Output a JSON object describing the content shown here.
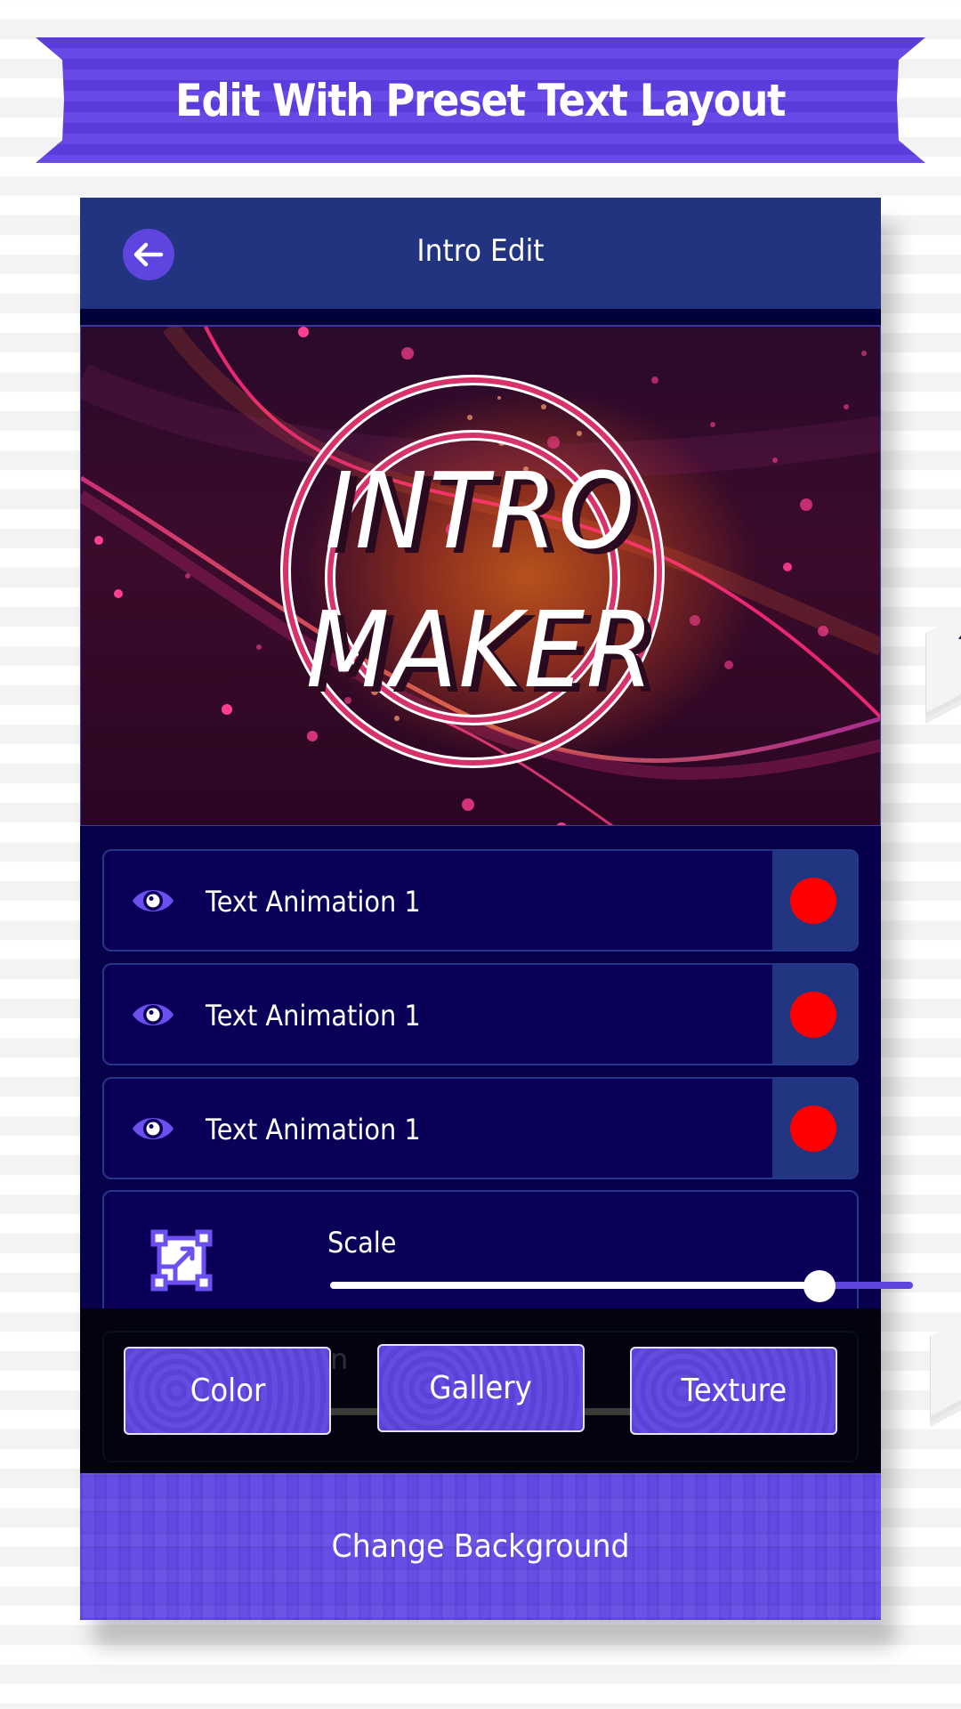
{
  "banner": {
    "title": "Edit With Preset Text Layout"
  },
  "app_header": {
    "title": "Intro Edit",
    "back_icon": "arrow-left-icon"
  },
  "preview": {
    "line1": "INTRO",
    "line2": "MAKER"
  },
  "layers": [
    {
      "label": "Text Animation 1",
      "icon": "eye-icon",
      "color": "#ff0000"
    },
    {
      "label": "Text Animation 1",
      "icon": "eye-icon",
      "color": "#ff0000"
    },
    {
      "label": "Text Animation 1",
      "icon": "eye-icon",
      "color": "#ff0000"
    }
  ],
  "scale": {
    "label": "Scale",
    "icon": "resize-icon",
    "value_fraction": 0.84
  },
  "hidden_section": {
    "partial_label": "tion"
  },
  "options": {
    "color_label": "Color",
    "gallery_label": "Gallery",
    "texture_label": "Texture"
  },
  "footer": {
    "change_background_label": "Change Background"
  },
  "colors": {
    "accent": "#5f44e0",
    "header": "#22347f",
    "panel": "#0b0058",
    "swatch": "#ff0000"
  }
}
